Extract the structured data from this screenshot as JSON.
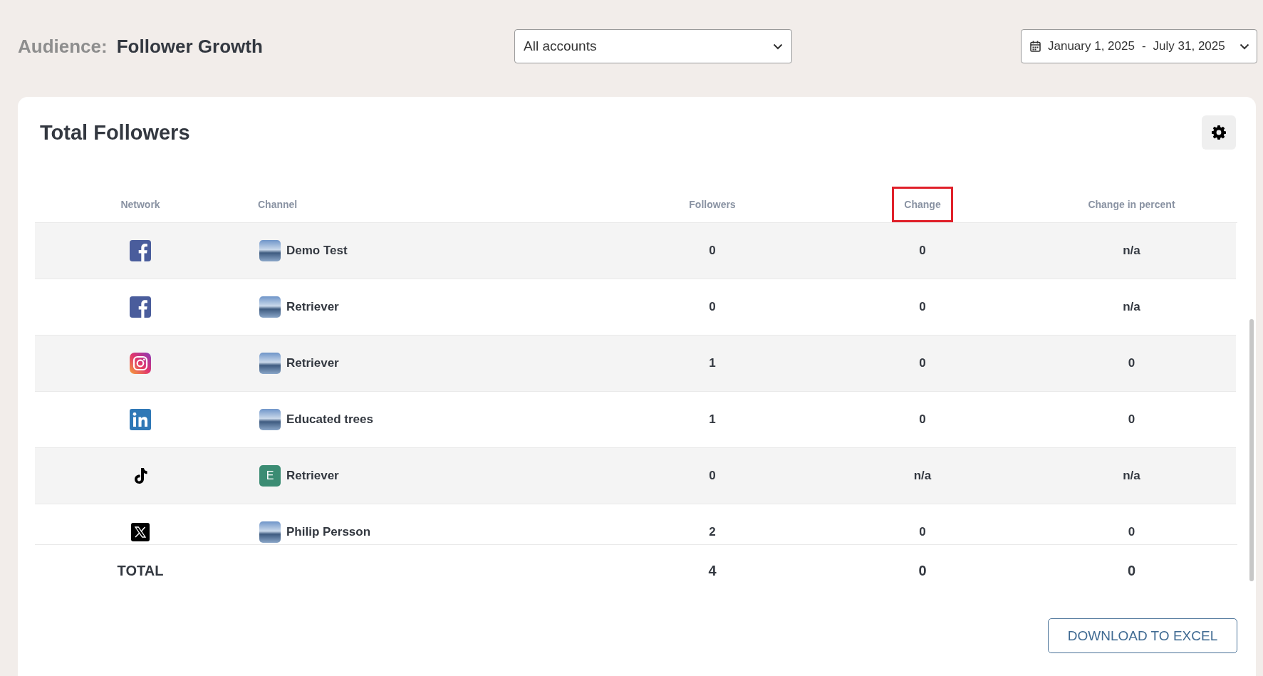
{
  "header": {
    "section": "Audience:",
    "title": "Follower Growth"
  },
  "account_select": {
    "value": "All accounts"
  },
  "date_range": {
    "start": "January 1, 2025",
    "separator": "-",
    "end": "July 31, 2025"
  },
  "card": {
    "title": "Total Followers",
    "table": {
      "columns": [
        {
          "label": "Network",
          "highlighted": false
        },
        {
          "label": "Channel",
          "highlighted": false
        },
        {
          "label": "Followers",
          "highlighted": false
        },
        {
          "label": "Change",
          "highlighted": true
        },
        {
          "label": "Change in percent",
          "highlighted": false
        }
      ],
      "rows": [
        {
          "kind": "f",
          "avatar": {
            "kind": "photo"
          },
          "channel": "Demo Test",
          "followers": "0",
          "change": "0",
          "change_percent": "n/a"
        },
        {
          "kind": "f",
          "avatar": {
            "kind": "photo"
          },
          "channel": "Retriever",
          "followers": "0",
          "change": "0",
          "change_percent": "n/a"
        },
        {
          "kind": "camera",
          "avatar": {
            "kind": "photo"
          },
          "channel": "Retriever",
          "followers": "1",
          "change": "0",
          "change_percent": "0"
        },
        {
          "kind": "in",
          "avatar": {
            "kind": "photo"
          },
          "channel": "Educated trees",
          "followers": "1",
          "change": "0",
          "change_percent": "0"
        },
        {
          "kind": "note",
          "avatar": {
            "kind": "letter",
            "letter": "E"
          },
          "channel": "Retriever",
          "followers": "0",
          "change": "n/a",
          "change_percent": "n/a"
        },
        {
          "kind": "x",
          "avatar": {
            "kind": "photo"
          },
          "channel": "Philip Persson",
          "followers": "2",
          "change": "0",
          "change_percent": "0"
        }
      ],
      "total": {
        "label": "TOTAL",
        "followers": "4",
        "change": "0",
        "change_percent": "0"
      }
    },
    "download_button": "DOWNLOAD TO EXCEL"
  }
}
